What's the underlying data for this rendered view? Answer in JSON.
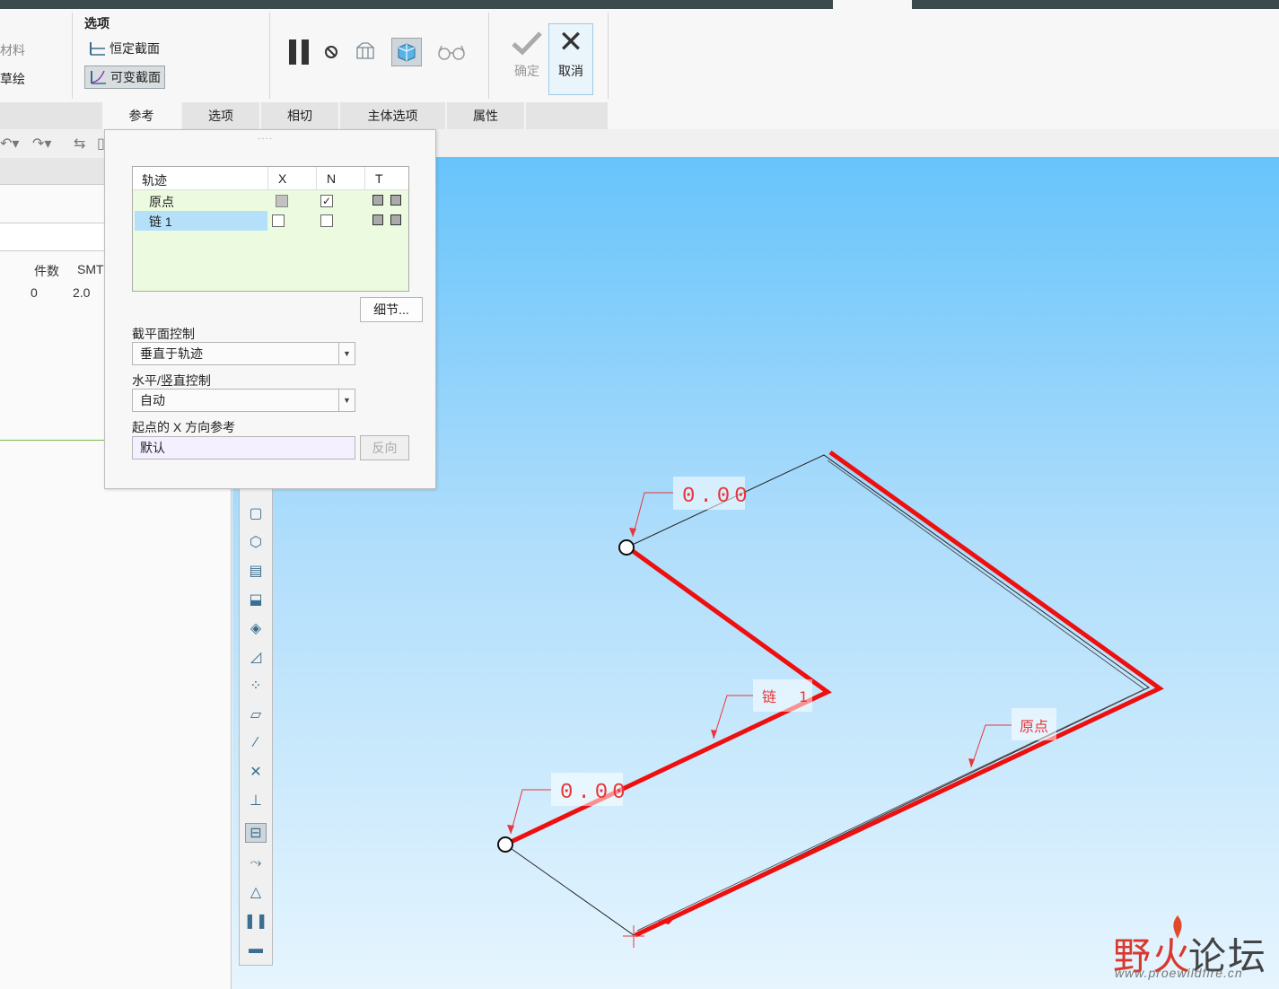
{
  "ribbon": {
    "left_items": [
      "材料",
      "草绘"
    ],
    "options_title": "选项",
    "constant_section": "恒定截面",
    "variable_section": "可变截面",
    "confirm": "确定",
    "cancel": "取消"
  },
  "tabs": [
    "参考",
    "选项",
    "相切",
    "主体选项",
    "属性"
  ],
  "left_panel": {
    "col_count": "件数",
    "col_smt": "SMT",
    "val_count": "0",
    "val_smt": "2.0"
  },
  "dialog": {
    "table": {
      "headers": [
        "轨迹",
        "X",
        "N",
        "T"
      ],
      "rows": [
        {
          "name": "原点",
          "x": "grey",
          "n": true
        },
        {
          "name": "链 1",
          "x": false,
          "n": false
        }
      ]
    },
    "details_button": "细节...",
    "section_control_label": "截平面控制",
    "section_control_value": "垂直于轨迹",
    "hv_control_label": "水平/竖直控制",
    "hv_control_value": "自动",
    "x_ref_label": "起点的 X 方向参考",
    "x_ref_value": "默认",
    "reverse_button": "反向"
  },
  "viewport": {
    "dim_top": "0.00",
    "dim_bottom": "0.00",
    "chain_label": "链 1",
    "origin_label": "原点",
    "trajectory_color": "#ee0f0f",
    "annotation_color": "#e8353a"
  },
  "logo": {
    "cn_red": "野火",
    "cn_dark": "论坛",
    "url": "www.proewildfire.cn"
  }
}
